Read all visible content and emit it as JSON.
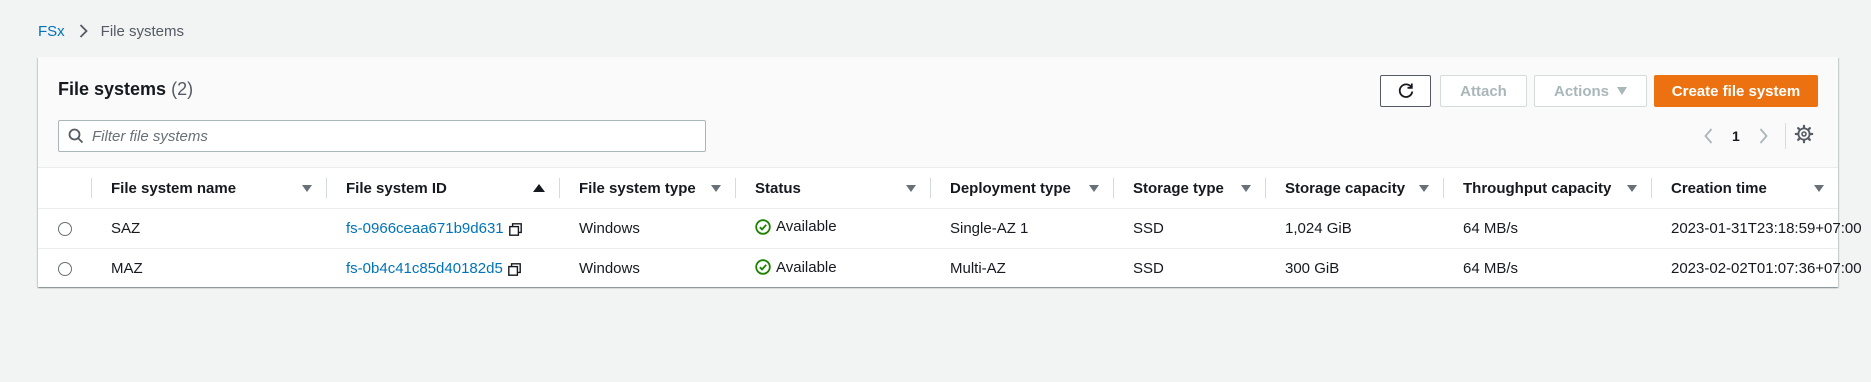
{
  "breadcrumb": {
    "root": "FSx",
    "current": "File systems"
  },
  "header": {
    "title": "File systems",
    "count": "(2)"
  },
  "toolbar": {
    "attach_label": "Attach",
    "actions_label": "Actions",
    "create_label": "Create file system"
  },
  "search": {
    "placeholder": "Filter file systems"
  },
  "pagination": {
    "current_page": "1"
  },
  "table": {
    "columns": [
      "File system name",
      "File system ID",
      "File system type",
      "Status",
      "Deployment type",
      "Storage type",
      "Storage capacity",
      "Throughput capacity",
      "Creation time"
    ],
    "sorted_column": "File system ID",
    "rows": [
      {
        "name": "SAZ",
        "id": "fs-0966ceaa671b9d631",
        "type": "Windows",
        "status": "Available",
        "deployment": "Single-AZ 1",
        "storage_type": "SSD",
        "capacity": "1,024 GiB",
        "throughput": "64 MB/s",
        "created": "2023-01-31T23:18:59+07:00"
      },
      {
        "name": "MAZ",
        "id": "fs-0b4c41c85d40182d5",
        "type": "Windows",
        "status": "Available",
        "deployment": "Multi-AZ",
        "storage_type": "SSD",
        "capacity": "300 GiB",
        "throughput": "64 MB/s",
        "created": "2023-02-02T01:07:36+07:00"
      }
    ]
  },
  "colors": {
    "link": "#0073bb",
    "primary": "#ec7211",
    "success": "#1d8102"
  }
}
